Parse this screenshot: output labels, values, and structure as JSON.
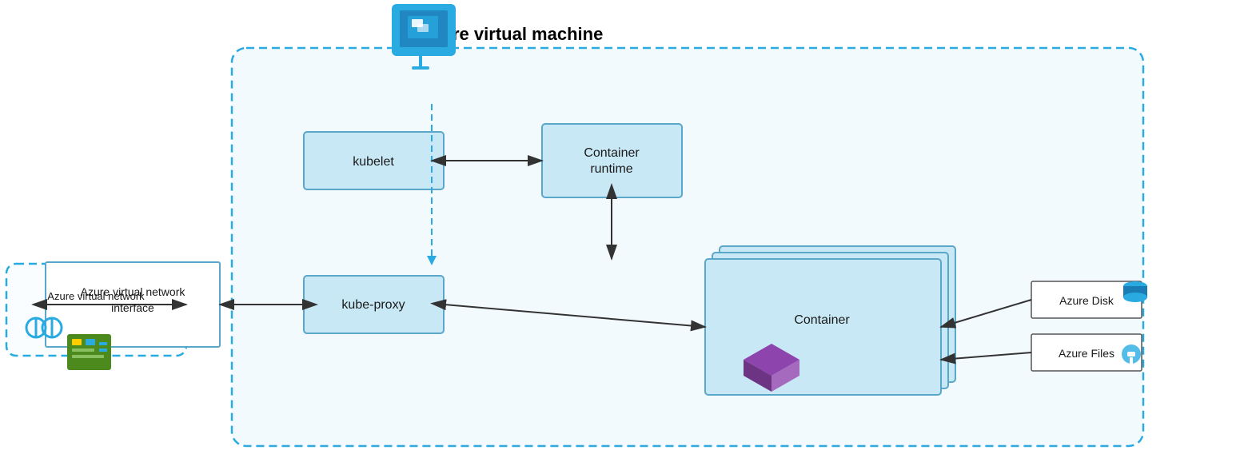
{
  "diagram": {
    "vm_label": "Azure virtual machine",
    "kubelet_label": "kubelet",
    "container_runtime_label": "Container\nruntime",
    "kube_proxy_label": "kube-proxy",
    "container_label": "Container",
    "vnet_interface_label": "Azure virtual network\ninterface",
    "vnet_label": "Azure virtual network",
    "azure_disk_label": "Azure Disk",
    "azure_files_label": "Azure Files",
    "colors": {
      "dashed_border": "#29abe2",
      "box_border": "#5ba7c9",
      "box_bg": "#c9e8f5",
      "vm_bg": "rgba(219,241,252,0.35)"
    }
  }
}
